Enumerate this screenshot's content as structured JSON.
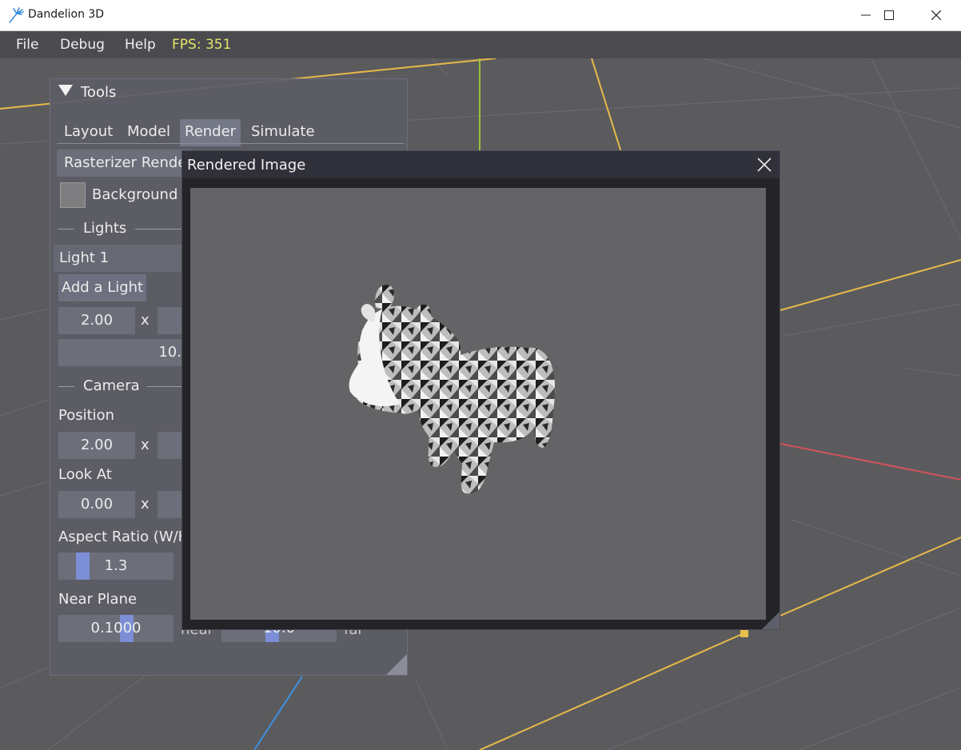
{
  "window": {
    "title": "Dandelion 3D",
    "minimize_icon": "minimize-icon",
    "maximize_icon": "maximize-icon",
    "close_icon": "close-icon"
  },
  "menubar": {
    "items": [
      "File",
      "Debug",
      "Help"
    ],
    "fps": "FPS: 351"
  },
  "tools": {
    "header": "Tools",
    "tabs": [
      "Layout",
      "Model",
      "Render",
      "Simulate"
    ],
    "active_tab": "Render",
    "renderer_label": "Rasterizer Rende",
    "background_label": "Background (",
    "lights_section": "Lights",
    "light_selected": "Light 1",
    "add_light_button": "Add a Light",
    "light_pos_x": "2.00",
    "axis_x": "x",
    "light_intensity": "10.",
    "camera_section": "Camera",
    "position_label": "Position",
    "position_x": "2.00",
    "lookat_label": "Look At",
    "lookat_x": "0.00",
    "aspect_label": "Aspect Ratio (W/H",
    "aspect_value": "1.3",
    "near_label": "Near Plane",
    "near_value": "0.1000",
    "near_suffix": "near",
    "far_value": "10.0",
    "far_suffix": "far"
  },
  "render_window": {
    "title": "Rendered Image",
    "close_icon": "close-icon"
  },
  "colors": {
    "fps": "#e6e36a",
    "accent": "#7b8ed6",
    "grid_yellow": "#e8b94a",
    "axis_red": "#d4525a",
    "axis_green": "#9ac23c",
    "axis_blue": "#3f8ee0"
  }
}
